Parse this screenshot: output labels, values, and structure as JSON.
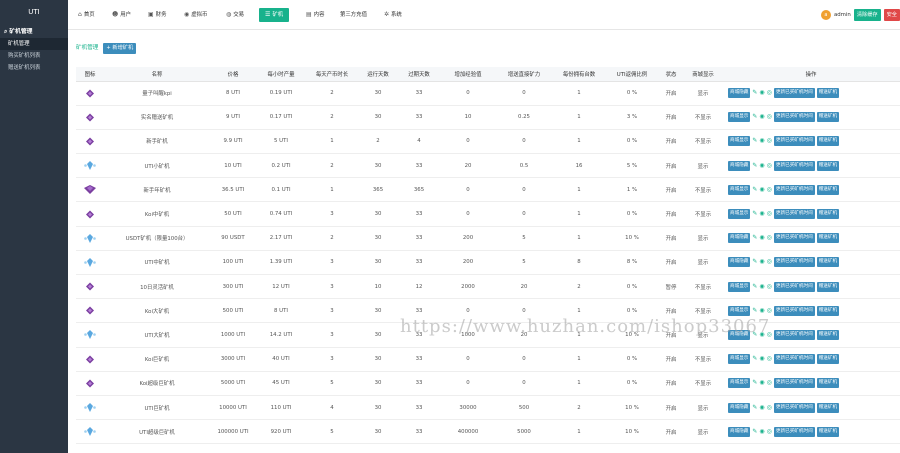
{
  "sidebar": {
    "logo": "UTI",
    "group": "矿机管理",
    "items": [
      {
        "label": "矿机管理",
        "active": true
      },
      {
        "label": "购买矿机列表",
        "active": false
      },
      {
        "label": "赠送矿机列表",
        "active": false
      }
    ]
  },
  "topnav": {
    "items": [
      {
        "label": "首页",
        "icon": "home-icon"
      },
      {
        "label": "用户",
        "icon": "user-icon"
      },
      {
        "label": "财务",
        "icon": "finance-icon"
      },
      {
        "label": "虚拟币",
        "icon": "coin-icon"
      },
      {
        "label": "交易",
        "icon": "trade-icon"
      },
      {
        "label": "矿机",
        "icon": "list-icon",
        "active": true
      },
      {
        "label": "内容",
        "icon": "content-icon"
      },
      {
        "label": "第三方充值",
        "icon": ""
      },
      {
        "label": "系统",
        "icon": "gear-icon"
      }
    ],
    "user": "admin",
    "clear_cache": "清除缓存",
    "safe_exit": "安全"
  },
  "page": {
    "tab": "矿机管理",
    "add_button": "+ 新增矿机"
  },
  "columns": [
    "图标",
    "名称",
    "价格",
    "每小时产量",
    "每天产币时长",
    "运行天数",
    "过期天数",
    "增加经验值",
    "增送直接矿力",
    "每份拥有台数",
    "UTI返佣比例",
    "状态",
    "商城显示",
    "操作"
  ],
  "rows": [
    {
      "icon": "purple",
      "name": "量子叫醒kpi",
      "price": "8 UTI",
      "hourly": "0.19 UTI",
      "daily": "2",
      "run": "30",
      "expire": "33",
      "exp": "0",
      "power": "0",
      "units": "1",
      "ratio": "0 %",
      "status": "开启",
      "show": "显示",
      "toggle": "商城隐藏"
    },
    {
      "icon": "purple",
      "name": "实名赠送矿机",
      "price": "9 UTI",
      "hourly": "0.17 UTI",
      "daily": "2",
      "run": "30",
      "expire": "33",
      "exp": "10",
      "power": "0.25",
      "units": "1",
      "ratio": "3 %",
      "status": "开启",
      "show": "不显示",
      "toggle": "商城显示"
    },
    {
      "icon": "purple",
      "name": "新手矿机",
      "price": "9.9 UTI",
      "hourly": "5 UTI",
      "daily": "1",
      "run": "2",
      "expire": "4",
      "exp": "0",
      "power": "0",
      "units": "1",
      "ratio": "0 %",
      "status": "开启",
      "show": "不显示",
      "toggle": "商城显示"
    },
    {
      "icon": "blue",
      "name": "UTI小矿机",
      "price": "10 UTI",
      "hourly": "0.2 UTI",
      "daily": "2",
      "run": "30",
      "expire": "33",
      "exp": "20",
      "power": "0.5",
      "units": "16",
      "ratio": "5 %",
      "status": "开启",
      "show": "显示",
      "toggle": "商城隐藏"
    },
    {
      "icon": "purple2",
      "name": "新手年矿机",
      "price": "36.5 UTI",
      "hourly": "0.1 UTI",
      "daily": "1",
      "run": "365",
      "expire": "365",
      "exp": "0",
      "power": "0",
      "units": "1",
      "ratio": "1 %",
      "status": "开启",
      "show": "不显示",
      "toggle": "商城显示"
    },
    {
      "icon": "purple",
      "name": "Koi中矿机",
      "price": "50 UTI",
      "hourly": "0.74 UTI",
      "daily": "3",
      "run": "30",
      "expire": "33",
      "exp": "0",
      "power": "0",
      "units": "1",
      "ratio": "0 %",
      "status": "开启",
      "show": "不显示",
      "toggle": "商城显示"
    },
    {
      "icon": "blue",
      "name": "USDT矿机（限量100台）",
      "price": "90 USDT",
      "hourly": "2.17 UTI",
      "daily": "2",
      "run": "30",
      "expire": "33",
      "exp": "200",
      "power": "5",
      "units": "1",
      "ratio": "10 %",
      "status": "开启",
      "show": "显示",
      "toggle": "商城隐藏"
    },
    {
      "icon": "blue",
      "name": "UTI中矿机",
      "price": "100 UTI",
      "hourly": "1.39 UTI",
      "daily": "3",
      "run": "30",
      "expire": "33",
      "exp": "200",
      "power": "5",
      "units": "8",
      "ratio": "8 %",
      "status": "开启",
      "show": "显示",
      "toggle": "商城隐藏"
    },
    {
      "icon": "purple",
      "name": "10日灵活矿机",
      "price": "300 UTI",
      "hourly": "12 UTI",
      "daily": "3",
      "run": "10",
      "expire": "12",
      "exp": "2000",
      "power": "20",
      "units": "2",
      "ratio": "0 %",
      "status": "暂停",
      "show": "不显示",
      "toggle": "商城显示"
    },
    {
      "icon": "purple",
      "name": "Koi大矿机",
      "price": "500 UTI",
      "hourly": "8 UTI",
      "daily": "3",
      "run": "30",
      "expire": "33",
      "exp": "0",
      "power": "0",
      "units": "1",
      "ratio": "0 %",
      "status": "开启",
      "show": "不显示",
      "toggle": "商城显示"
    },
    {
      "icon": "blue",
      "name": "UTI大矿机",
      "price": "1000 UTI",
      "hourly": "14.2 UTI",
      "daily": "3",
      "run": "30",
      "expire": "33",
      "exp": "1000",
      "power": "20",
      "units": "1",
      "ratio": "10 %",
      "status": "开启",
      "show": "显示",
      "toggle": "商城隐藏"
    },
    {
      "icon": "purple",
      "name": "Koi巨矿机",
      "price": "3000 UTI",
      "hourly": "40 UTI",
      "daily": "3",
      "run": "30",
      "expire": "33",
      "exp": "0",
      "power": "0",
      "units": "1",
      "ratio": "0 %",
      "status": "开启",
      "show": "不显示",
      "toggle": "商城显示"
    },
    {
      "icon": "purple",
      "name": "Koi超级巨矿机",
      "price": "5000 UTI",
      "hourly": "45 UTI",
      "daily": "5",
      "run": "30",
      "expire": "33",
      "exp": "0",
      "power": "0",
      "units": "1",
      "ratio": "0 %",
      "status": "开启",
      "show": "不显示",
      "toggle": "商城显示"
    },
    {
      "icon": "blue",
      "name": "UTI巨矿机",
      "price": "10000 UTI",
      "hourly": "110 UTI",
      "daily": "4",
      "run": "30",
      "expire": "33",
      "exp": "30000",
      "power": "500",
      "units": "2",
      "ratio": "10 %",
      "status": "开启",
      "show": "显示",
      "toggle": "商城隐藏"
    },
    {
      "icon": "blue",
      "name": "UTI超级巨矿机",
      "price": "100000 UTI",
      "hourly": "920 UTI",
      "daily": "5",
      "run": "30",
      "expire": "33",
      "exp": "400000",
      "power": "5000",
      "units": "1",
      "ratio": "10 %",
      "status": "开启",
      "show": "显示",
      "toggle": "商城隐藏"
    }
  ],
  "row_actions": {
    "update": "更新已买矿机时间",
    "gift": "赠送矿机"
  },
  "watermark": "https://www.huzhan.com/ishop33067",
  "colors": {
    "sidebar": "#2b3643",
    "accent": "#18b28c",
    "button": "#3c8dbc",
    "gem_purple": "#7b3fa0",
    "gem_blue": "#5aa8e0"
  }
}
